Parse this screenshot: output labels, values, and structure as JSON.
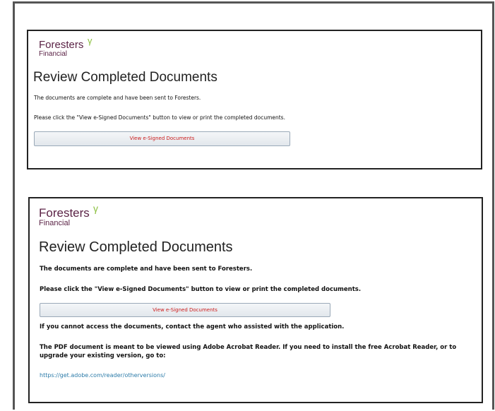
{
  "brand": {
    "name": "Foresters",
    "sub": "Financial"
  },
  "panel1": {
    "title": "Review Completed Documents",
    "line1": "The documents are complete and have been sent to Foresters.",
    "line2": "Please click the \"View e-Signed Documents\" button to view or print the completed documents.",
    "button": "View e-Signed Documents"
  },
  "panel2": {
    "title": "Review Completed Documents",
    "line1": "The documents are complete and have been sent to Foresters.",
    "line2": "Please click the \"View e-Signed Documents\" button to view or print the completed documents.",
    "button": "View e-Signed Documents",
    "line3": "If you cannot access the documents, contact the agent who assisted with the application.",
    "line4a": "The PDF document is meant to be viewed using Adobe Acrobat Reader. If you need to install the free Acrobat Reader, or to",
    "line4b": "upgrade your existing version, go to:",
    "link": "https://get.adobe.com/reader/otherversions/"
  },
  "colors": {
    "brand": "#5b2346",
    "leaf": "#8bbf3f",
    "button_text": "#cc1b1b",
    "link": "#2a7aa8"
  }
}
